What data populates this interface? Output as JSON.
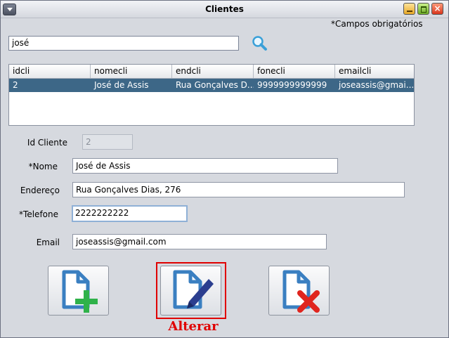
{
  "window": {
    "title": "Clientes"
  },
  "required_note": "*Campos obrigatórios",
  "search": {
    "value": "josé"
  },
  "table": {
    "columns": [
      "idcli",
      "nomecli",
      "endcli",
      "fonecli",
      "emailcli"
    ],
    "rows": [
      [
        "2",
        "José de Assis",
        "Rua Gonçalves D...",
        "9999999999999",
        "joseassis@gmai..."
      ]
    ]
  },
  "form": {
    "id_label": "Id Cliente",
    "id_value": "2",
    "name_label": "*Nome",
    "name_value": "José de Assis",
    "address_label": "Endereço",
    "address_value": "Rua Gonçalves Dias, 276",
    "phone_label": "*Telefone",
    "phone_value": "2222222222",
    "email_label": "Email",
    "email_value": "joseassis@gmail.com"
  },
  "buttons": {
    "highlight_caption": "Alterar"
  },
  "icons": [
    "system-menu-icon",
    "minimize-icon",
    "maximize-icon",
    "close-icon",
    "search-icon",
    "add-document-icon",
    "edit-document-icon",
    "delete-document-icon"
  ],
  "colors": {
    "selection": "#3d6787",
    "highlight": "#e00000",
    "doc_blue": "#3a7fc1",
    "add_green": "#2fb24a",
    "delete_red": "#e0251e"
  }
}
